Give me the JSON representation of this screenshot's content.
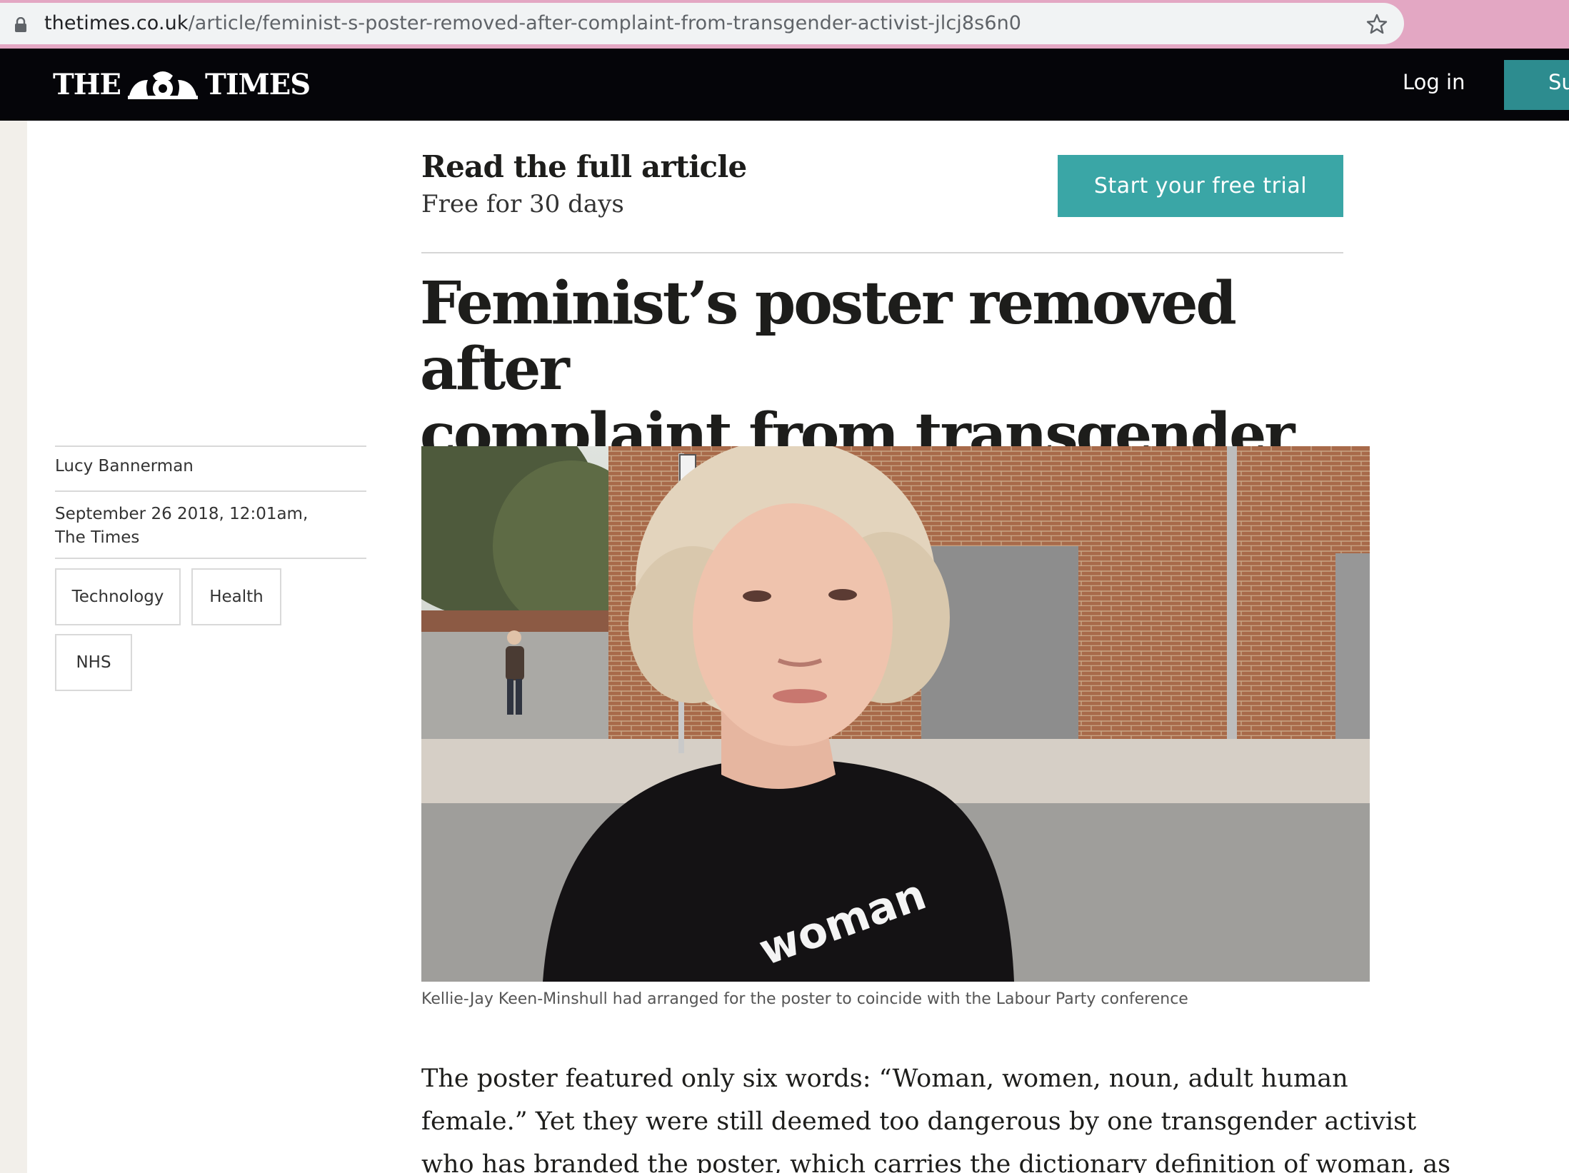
{
  "browser": {
    "url_domain": "thetimes.co.uk",
    "url_path": "/article/feminist-s-poster-removed-after-complaint-from-transgender-activist-jlcj8s6n0"
  },
  "header": {
    "logo_left": "THE",
    "logo_right": "TIMES",
    "login_label": "Log in",
    "subscribe_label": "Su"
  },
  "promo": {
    "title": "Read the full article",
    "subtitle": "Free for 30 days",
    "trial_button": "Start your free trial"
  },
  "article": {
    "headline_line1": "Feminist’s poster removed after",
    "headline_line2": "complaint from transgender activist",
    "author": "Lucy Bannerman",
    "date_line1": "September 26 2018, 12:01am,",
    "date_line2": "The Times",
    "tags": [
      "Technology",
      "Health",
      "NHS"
    ],
    "image_shirt_text": "woman",
    "caption": "Kellie-Jay Keen-Minshull had arranged for the poster to coincide with the Labour Party conference",
    "body_lines": [
      "The poster featured only six words: “Woman, women, noun, adult human",
      "female.” Yet they were still deemed too dangerous by one transgender activist",
      "who has branded the poster, which carries the dictionary definition of woman, as"
    ]
  },
  "colors": {
    "chrome_bar": "#e3a7c3",
    "header_bg": "#050509",
    "accent_teal": "#3aa6a6",
    "subscribe_teal": "#2d8c8f"
  }
}
